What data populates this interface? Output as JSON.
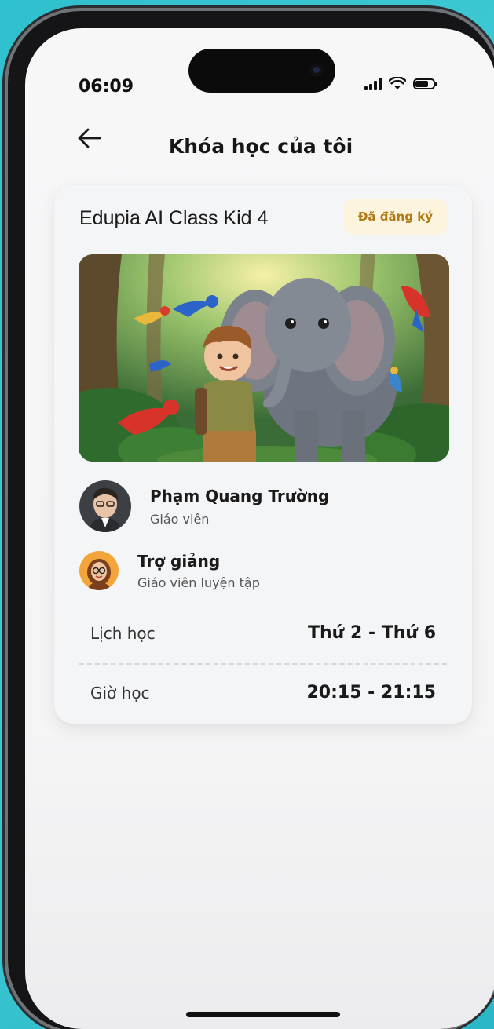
{
  "status_bar": {
    "time": "06:09"
  },
  "header": {
    "title": "Khóa học của tôi"
  },
  "course": {
    "title": "Edupia AI Class Kid 4",
    "badge": "Đã đăng ký",
    "teacher": {
      "name": "Phạm Quang Trường",
      "role": "Giáo viên"
    },
    "assistant": {
      "name": "Trợ giảng",
      "role": "Giáo viên luyện tập"
    },
    "schedule": {
      "label": "Lịch học",
      "value": "Thứ 2 - Thứ 6"
    },
    "time": {
      "label": "Giờ học",
      "value": "20:15 - 21:15"
    }
  },
  "icons": {
    "back": "arrow-left-icon",
    "signal": "cellular-signal-icon",
    "wifi": "wifi-icon",
    "battery": "battery-icon"
  },
  "colors": {
    "badge_bg": "#fdf4dd",
    "badge_text": "#b07a17",
    "background": "#2fc0cd"
  }
}
